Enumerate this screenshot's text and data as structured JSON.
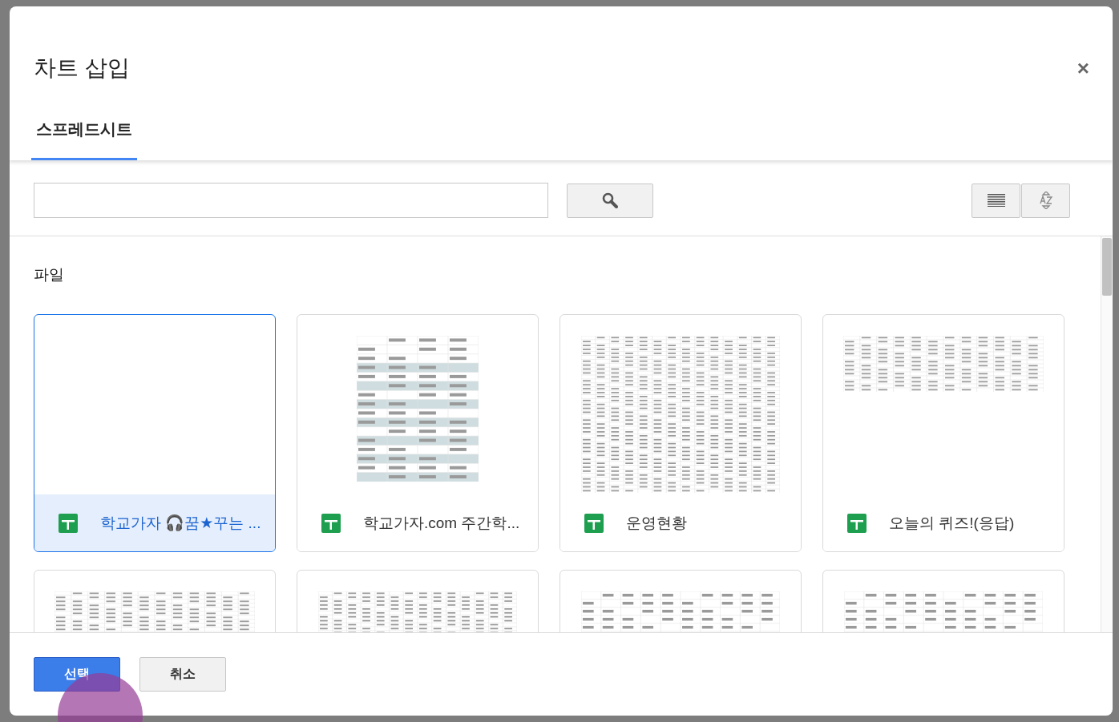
{
  "dialog": {
    "title": "차트 삽입",
    "close": "×"
  },
  "tabs": [
    {
      "label": "스프레드시트",
      "selected": true
    }
  ],
  "view_buttons": [
    {
      "kind": "list",
      "selected": false
    },
    {
      "kind": "sort",
      "selected": false
    }
  ],
  "section_title": "파일",
  "files": [
    {
      "name": "학교가자 🎧꿈★꾸는 ...",
      "selected": true,
      "kind": "blank"
    },
    {
      "name": "학교가자.com 주간학...",
      "selected": false,
      "kind": "narrow"
    },
    {
      "name": "운영현황",
      "selected": false,
      "kind": "dense"
    },
    {
      "name": "오늘의 퀴즈!(응답)",
      "selected": false,
      "kind": "wide"
    },
    {
      "selected": false,
      "kind": "wide"
    },
    {
      "selected": false,
      "kind": "dense"
    },
    {
      "selected": false,
      "kind": "app"
    },
    {
      "selected": false,
      "kind": "app"
    }
  ],
  "buttons": [
    {
      "label": "선택",
      "kind": "primary"
    },
    {
      "label": "취소",
      "kind": "secondary"
    }
  ]
}
